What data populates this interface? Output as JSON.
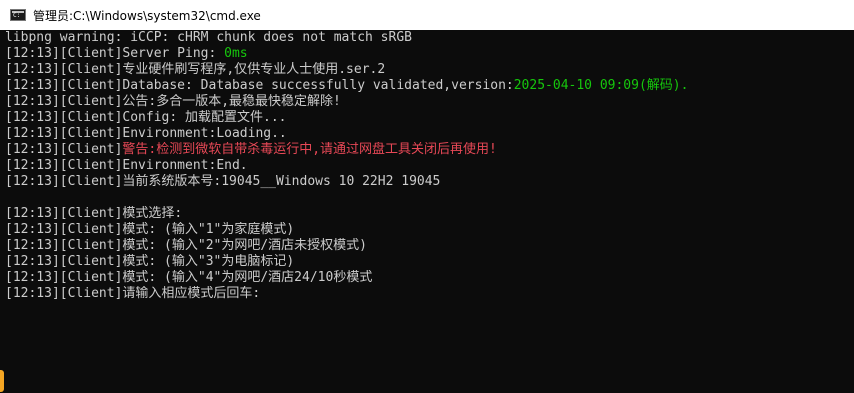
{
  "window": {
    "title": "管理员:C:\\Windows\\system32\\cmd.exe",
    "icon": "cmd-icon"
  },
  "colors": {
    "background": "#0c0c0c",
    "text": "#cccccc",
    "green": "#16c60c",
    "red": "#e74856"
  },
  "console": {
    "lines": [
      {
        "text": "libpng warning: iCCP: cHRM chunk does not match sRGB"
      },
      {
        "text": "[12:13][Client]Server Ping: ",
        "green": "0ms"
      },
      {
        "text": "[12:13][Client]专业硬件刷写程序,仅供专业人士使用.ser.2"
      },
      {
        "text": "[12:13][Client]Database: Database successfully validated,version:",
        "green": "2025-04-10 09:09(解码)."
      },
      {
        "text": "[12:13][Client]公告:多合一版本,最稳最快稳定解除!"
      },
      {
        "text": "[12:13][Client]Config: 加载配置文件..."
      },
      {
        "text": "[12:13][Client]Environment:Loading.."
      },
      {
        "text": "[12:13][Client]",
        "red": "警告:检测到微软自带杀毒运行中,请通过网盘工具关闭后再使用!"
      },
      {
        "text": "[12:13][Client]Environment:End."
      },
      {
        "text": "[12:13][Client]当前系统版本号:19045__Windows 10 22H2 19045"
      },
      {
        "text": ""
      },
      {
        "text": "[12:13][Client]模式选择:"
      },
      {
        "text": "[12:13][Client]模式: (输入\"1\"为家庭模式)"
      },
      {
        "text": "[12:13][Client]模式: (输入\"2\"为网吧/酒店未授权模式)"
      },
      {
        "text": "[12:13][Client]模式: (输入\"3\"为电脑标记)"
      },
      {
        "text": "[12:13][Client]模式: (输入\"4\"为网吧/酒店24/10秒模式"
      },
      {
        "text": "[12:13][Client]请输入相应模式后回车:"
      }
    ]
  }
}
